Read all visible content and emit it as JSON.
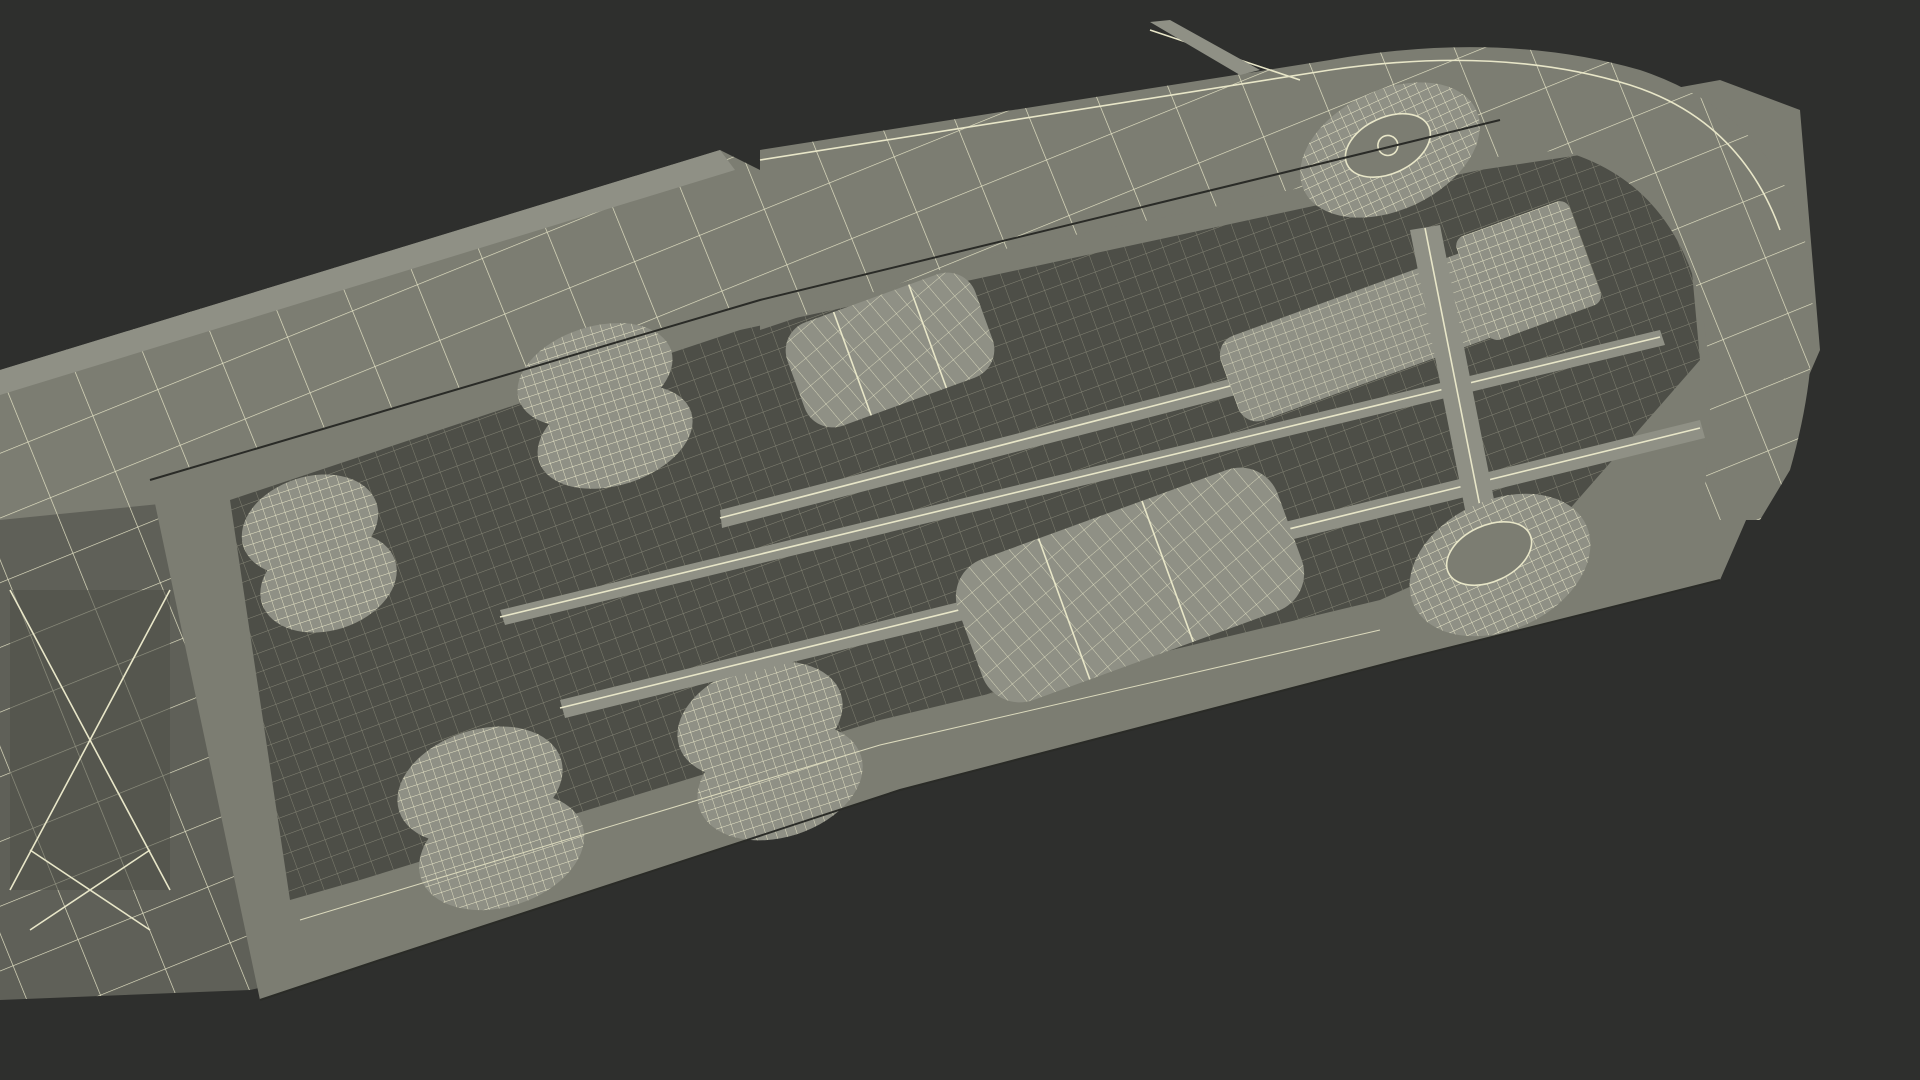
{
  "scene": {
    "background_color": "#2e2f2d",
    "model_fill_color": "#7c7d72",
    "wireframe_color": "#e8e6c8",
    "subject": "truck-underside-wireframe-render"
  }
}
